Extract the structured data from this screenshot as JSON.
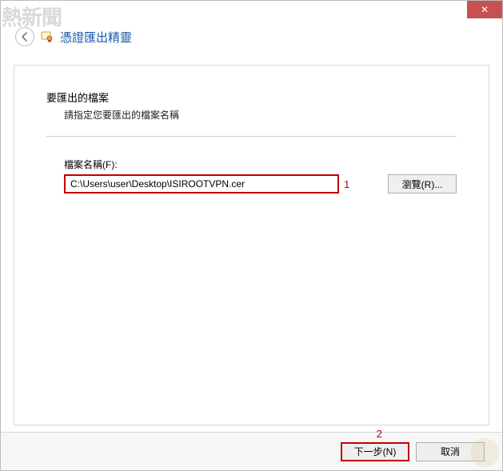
{
  "watermark": "熱新聞",
  "titlebar": {
    "close_glyph": "✕"
  },
  "header": {
    "title": "憑證匯出精靈"
  },
  "content": {
    "section_title": "要匯出的檔案",
    "section_sub": "請指定您要匯出的檔案名稱",
    "field_label": "檔案名稱(F):",
    "path_value": "C:\\Users\\user\\Desktop\\ISIROOTVPN.cer",
    "browse_label": "瀏覽(R)...",
    "callout_1": "1"
  },
  "footer": {
    "next_label": "下一步(N)",
    "cancel_label": "取消",
    "callout_2": "2"
  }
}
